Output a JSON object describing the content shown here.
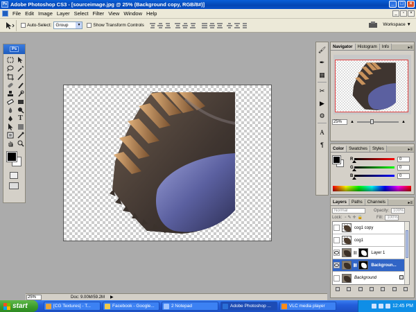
{
  "title_bar": {
    "title": "Adobe Photoshop CS3 - [sourceimage.jpg @ 25% (Background copy, RGB/8#)]",
    "logo": "Ps"
  },
  "menu": [
    "File",
    "Edit",
    "Image",
    "Layer",
    "Select",
    "Filter",
    "View",
    "Window",
    "Help"
  ],
  "options": {
    "auto_select_label": "Auto-Select:",
    "auto_select_value": "Group",
    "transform_label": "Show Transform Controls",
    "workspace": "Workspace"
  },
  "toolbox": {
    "badge": "Ps"
  },
  "status": {
    "zoom": "25%",
    "doc": "Doc: 9.00M/59.2M"
  },
  "navigator": {
    "tabs": [
      "Navigator",
      "Histogram",
      "Info"
    ],
    "zoom": "25%",
    "zoom_slider_fraction": 0.35
  },
  "color": {
    "tabs": [
      "Color",
      "Swatches",
      "Styles"
    ],
    "channels": [
      {
        "label": "R",
        "value": "0"
      },
      {
        "label": "G",
        "value": "0"
      },
      {
        "label": "B",
        "value": "0"
      }
    ]
  },
  "layers": {
    "tabs": [
      "Layers",
      "Paths",
      "Channels"
    ],
    "blend_mode": "Normal",
    "opacity_label": "Opacity:",
    "opacity_value": "100%",
    "lock_label": "Lock:",
    "fill_label": "Fill:",
    "fill_value": "100%",
    "items": [
      {
        "name": "cog1 copy",
        "visible": false
      },
      {
        "name": "cog1",
        "visible": false
      },
      {
        "name": "Layer 1",
        "visible": true
      },
      {
        "name": "Background copy",
        "visible": true,
        "selected": true
      },
      {
        "name": "Background",
        "visible": false,
        "locked": true
      }
    ],
    "selected_label": "Backgroun..."
  },
  "taskbar": {
    "start": "start",
    "tasks": [
      {
        "label": "[CG Textures] - T...",
        "color": "#e8a33a"
      },
      {
        "label": "Facebook - Google...",
        "color": "#f2c94c"
      },
      {
        "label": "2 Notepad",
        "color": "#9fc3ff"
      },
      {
        "label": "Adobe Photoshop ...",
        "color": "#2a6fd6",
        "active": true
      },
      {
        "label": "VLC media player",
        "color": "#ff8c1a"
      }
    ],
    "clock": "12:45 PM"
  }
}
